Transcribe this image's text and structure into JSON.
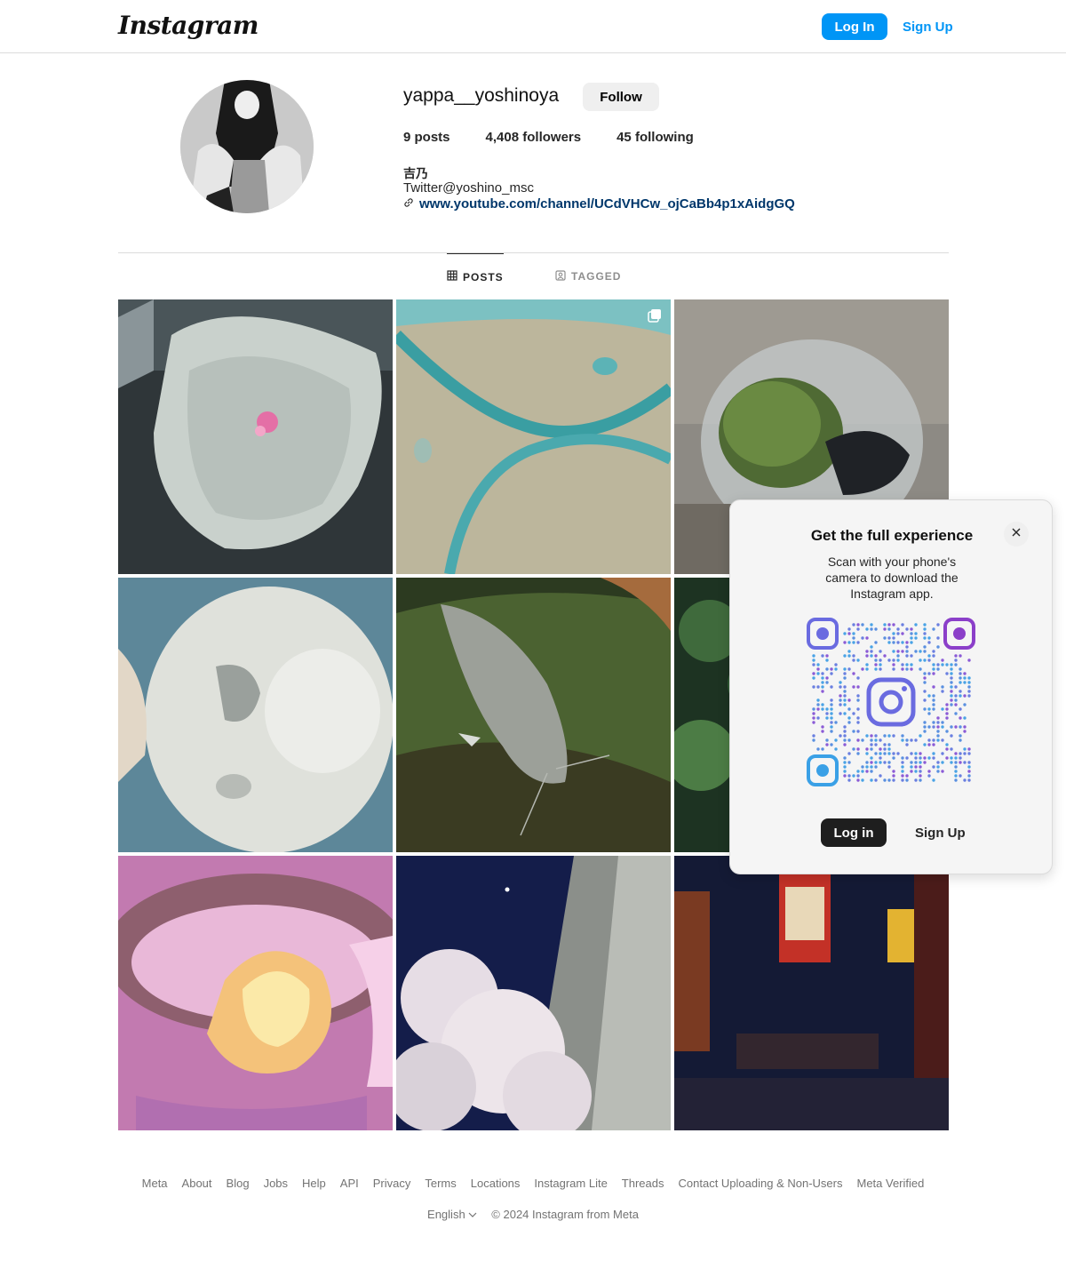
{
  "header": {
    "logo": "Instagram",
    "login_label": "Log In",
    "signup_label": "Sign Up"
  },
  "profile": {
    "username": "yappa__yoshinoya",
    "follow_label": "Follow",
    "posts_count": "9",
    "posts_label": " posts",
    "followers_count": "4,408",
    "followers_label": " followers",
    "following_count": "45",
    "following_label": " following",
    "bio_name": "吉乃",
    "bio_text": "Twitter@yoshino_msc",
    "bio_link": "www.youtube.com/channel/UCdVHCw_ojCaBb4p1xAidgGQ"
  },
  "tabs": [
    {
      "label": "POSTS",
      "icon": "grid-icon",
      "active": true
    },
    {
      "label": "TAGGED",
      "icon": "tag-icon",
      "active": false
    }
  ],
  "posts": [
    {
      "subject": "stadium-seat-with-pink-toy",
      "multi": false
    },
    {
      "subject": "teal-swirl-texture",
      "multi": true
    },
    {
      "subject": "moss-ball-in-glass-bowl",
      "multi": false
    },
    {
      "subject": "white-blob-closeup",
      "multi": false
    },
    {
      "subject": "catfish-in-aquarium",
      "multi": false
    },
    {
      "subject": "green-leaves",
      "multi": false
    },
    {
      "subject": "grill-with-flames-pink-effects",
      "multi": false
    },
    {
      "subject": "cherry-blossoms-at-night",
      "multi": false
    },
    {
      "subject": "night-street-neon-signs",
      "multi": false
    }
  ],
  "footer": {
    "links": [
      "Meta",
      "About",
      "Blog",
      "Jobs",
      "Help",
      "API",
      "Privacy",
      "Terms",
      "Locations",
      "Instagram Lite",
      "Threads",
      "Contact Uploading & Non-Users",
      "Meta Verified"
    ],
    "language": "English",
    "copyright": "© 2024 Instagram from Meta"
  },
  "popup": {
    "title": "Get the full experience",
    "description": "Scan with your phone's camera to download the Instagram app.",
    "login_label": "Log in",
    "signup_label": "Sign Up"
  }
}
